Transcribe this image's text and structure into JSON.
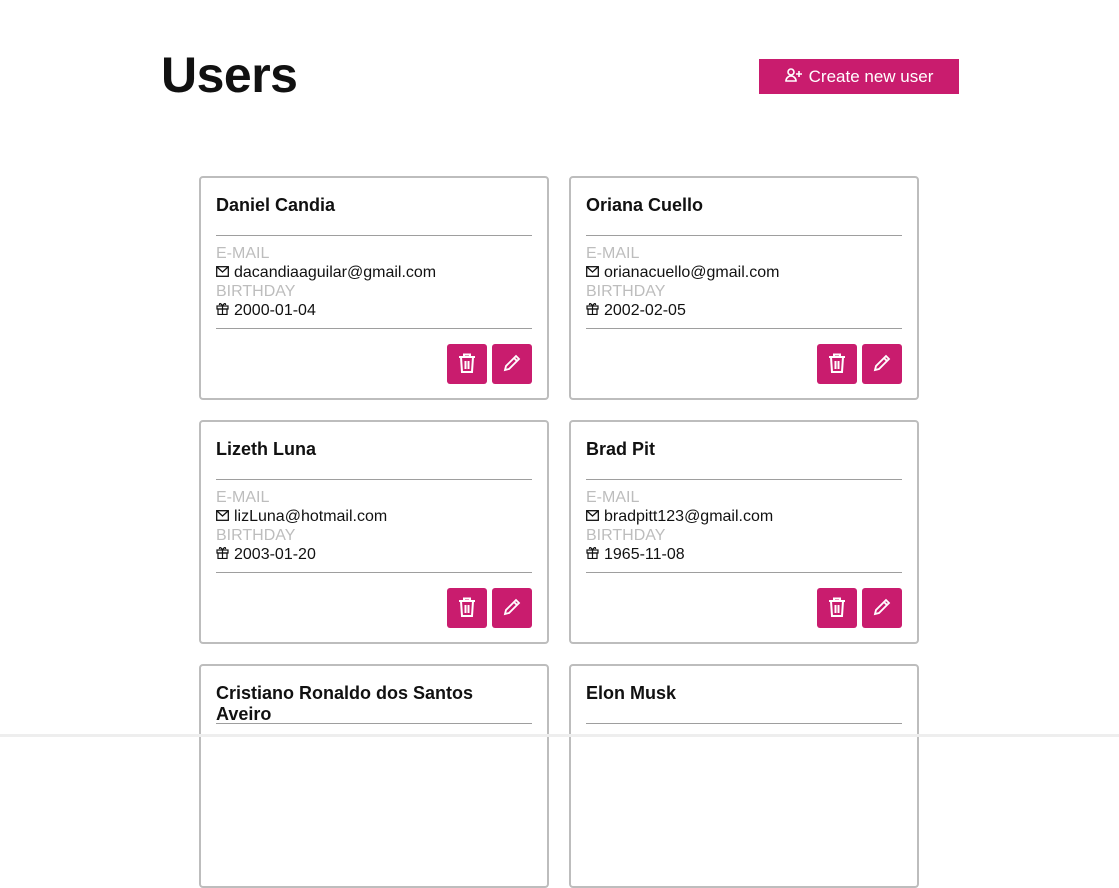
{
  "header": {
    "title": "Users",
    "create_label": "Create new user"
  },
  "labels": {
    "email": "E-MAIL",
    "birthday": "BIRTHDAY"
  },
  "accent": "#c91c6e",
  "users": [
    {
      "name": "Daniel Candia",
      "email": "dacandiaaguilar@gmail.com",
      "birthday": "2000-01-04"
    },
    {
      "name": "Oriana Cuello",
      "email": "orianacuello@gmail.com",
      "birthday": "2002-02-05"
    },
    {
      "name": "Lizeth Luna",
      "email": "lizLuna@hotmail.com",
      "birthday": "2003-01-20"
    },
    {
      "name": "Brad Pit",
      "email": "bradpitt123@gmail.com",
      "birthday": "1965-11-08"
    },
    {
      "name": "Cristiano Ronaldo dos Santos Aveiro"
    },
    {
      "name": "Elon Musk"
    }
  ]
}
